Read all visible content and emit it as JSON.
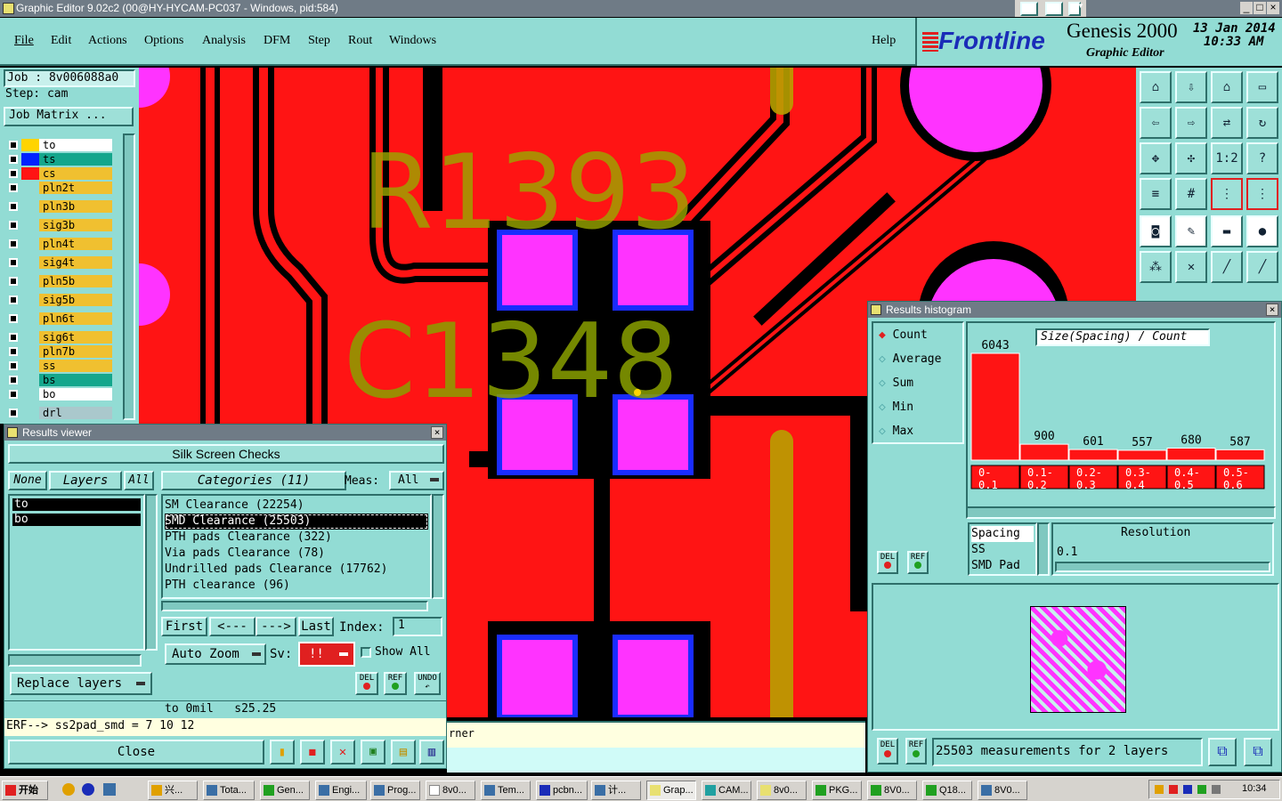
{
  "window": {
    "title": "Graphic Editor 9.02c2 (00@HY-HYCAM-PC037 - Windows, pid:584)"
  },
  "menu": {
    "items": [
      "File",
      "Edit",
      "Actions",
      "Options",
      "Analysis",
      "DFM",
      "Step",
      "Rout",
      "Windows"
    ],
    "help": "Help"
  },
  "brand": {
    "logo": "Frontline",
    "product": "Genesis 2000",
    "subtitle": "Graphic Editor",
    "date": "13 Jan 2014",
    "time": "10:33 AM"
  },
  "job": {
    "job": "Job : 8v006088a0",
    "step": "Step: cam",
    "matrix": "Job Matrix ..."
  },
  "layers": [
    {
      "name": "to",
      "color": "#ffffff",
      "swatch": "#ffd400"
    },
    {
      "name": "ts",
      "color": "#14a68c",
      "swatch": "#0022ff"
    },
    {
      "name": "cs",
      "color": "#f0c030",
      "swatch": "#ff1414"
    },
    {
      "name": "pln2t",
      "color": "#f0c030",
      "swatch": "#92dcd4"
    },
    {
      "name": "pln3b",
      "color": "#f0c030",
      "swatch": "#92dcd4"
    },
    {
      "name": "sig3b",
      "color": "#f0c030",
      "swatch": "#92dcd4"
    },
    {
      "name": "pln4t",
      "color": "#f0c030",
      "swatch": "#92dcd4"
    },
    {
      "name": "sig4t",
      "color": "#f0c030",
      "swatch": "#92dcd4"
    },
    {
      "name": "pln5b",
      "color": "#f0c030",
      "swatch": "#92dcd4"
    },
    {
      "name": "sig5b",
      "color": "#f0c030",
      "swatch": "#92dcd4"
    },
    {
      "name": "pln6t",
      "color": "#f0c030",
      "swatch": "#92dcd4"
    },
    {
      "name": "sig6t",
      "color": "#f0c030",
      "swatch": "#92dcd4"
    },
    {
      "name": "pln7b",
      "color": "#f0c030",
      "swatch": "#92dcd4"
    },
    {
      "name": "ss",
      "color": "#f0c030",
      "swatch": "#92dcd4"
    },
    {
      "name": "bs",
      "color": "#14a68c",
      "swatch": "#92dcd4"
    },
    {
      "name": "bo",
      "color": "#ffffff",
      "swatch": "#92dcd4"
    },
    {
      "name": "drl",
      "color": "#aac8cc",
      "swatch": "#92dcd4"
    }
  ],
  "board": {
    "labels": [
      "R1393",
      "C1348"
    ],
    "colors": {
      "copper": "#ff1414",
      "pad": "#ff33ff",
      "outline": "#1a2cff",
      "silk": "#b8a000",
      "silk2": "#5aa000"
    }
  },
  "results": {
    "title": "Results viewer",
    "header": "Silk Screen Checks",
    "none": "None",
    "layers_label": "Layers",
    "all": "All",
    "categories_label": "Categories (11)",
    "meas_label": "Meas:",
    "meas_value": "All",
    "layer_list": [
      "to",
      "bo"
    ],
    "categories": [
      "SM Clearance (22254)",
      "SMD Clearance (25503)",
      "PTH pads Clearance (322)",
      "Via pads Clearance (78)",
      "Undrilled pads Clearance (17762)",
      "PTH clearance (96)"
    ],
    "nav": {
      "first": "First",
      "prev": "<---",
      "next": "--->",
      "last": "Last",
      "index_label": "Index:",
      "index_value": "1"
    },
    "auto_zoom": "Auto Zoom",
    "sv_label": "Sv:",
    "sv_value": "!!",
    "show_all": "Show All",
    "replace": "Replace layers",
    "status1": "to 0mil   s25.25",
    "status2": "ERF--> ss2pad_smd = 7 10 12",
    "close": "Close",
    "del": "DEL",
    "ref": "REF",
    "undo": "UNDO"
  },
  "canvas_status": {
    "text": "rner"
  },
  "histogram": {
    "title": "Results histogram",
    "options": [
      "Count",
      "Average",
      "Sum",
      "Min",
      "Max"
    ],
    "chart_title": "Size(Spacing) / Count",
    "resolution_label": "Resolution",
    "resolution_value": "0.1",
    "types": [
      "Spacing",
      "SS",
      "SMD Pad"
    ],
    "summary": "25503 measurements for 2 layers",
    "del": "DEL",
    "ref": "REF"
  },
  "chart_data": {
    "type": "bar",
    "title": "Size(Spacing) / Count",
    "categories": [
      "0-0.1",
      "0.1-0.2",
      "0.2-0.3",
      "0.3-0.4",
      "0.4-0.5",
      "0.5-0.6"
    ],
    "bin_lines": [
      [
        "0-",
        "0.1"
      ],
      [
        "0.1-",
        "0.2"
      ],
      [
        "0.2-",
        "0.3"
      ],
      [
        "0.3-",
        "0.4"
      ],
      [
        "0.4-",
        "0.5"
      ],
      [
        "0.5-",
        "0.6"
      ]
    ],
    "values": [
      6043,
      900,
      601,
      557,
      680,
      587
    ],
    "ylim": [
      0,
      6043
    ],
    "color": "#ff1414"
  },
  "taskbar": {
    "start": "开始",
    "tasks": [
      "兴...",
      "Tota...",
      "Gen...",
      "Engi...",
      "Prog...",
      "8v0...",
      "Tem...",
      "pcbn...",
      "计...",
      "Grap...",
      "CAM...",
      "8v0...",
      "PKG...",
      "8V0...",
      "Q18...",
      "8V0..."
    ],
    "clock": "10:34"
  }
}
